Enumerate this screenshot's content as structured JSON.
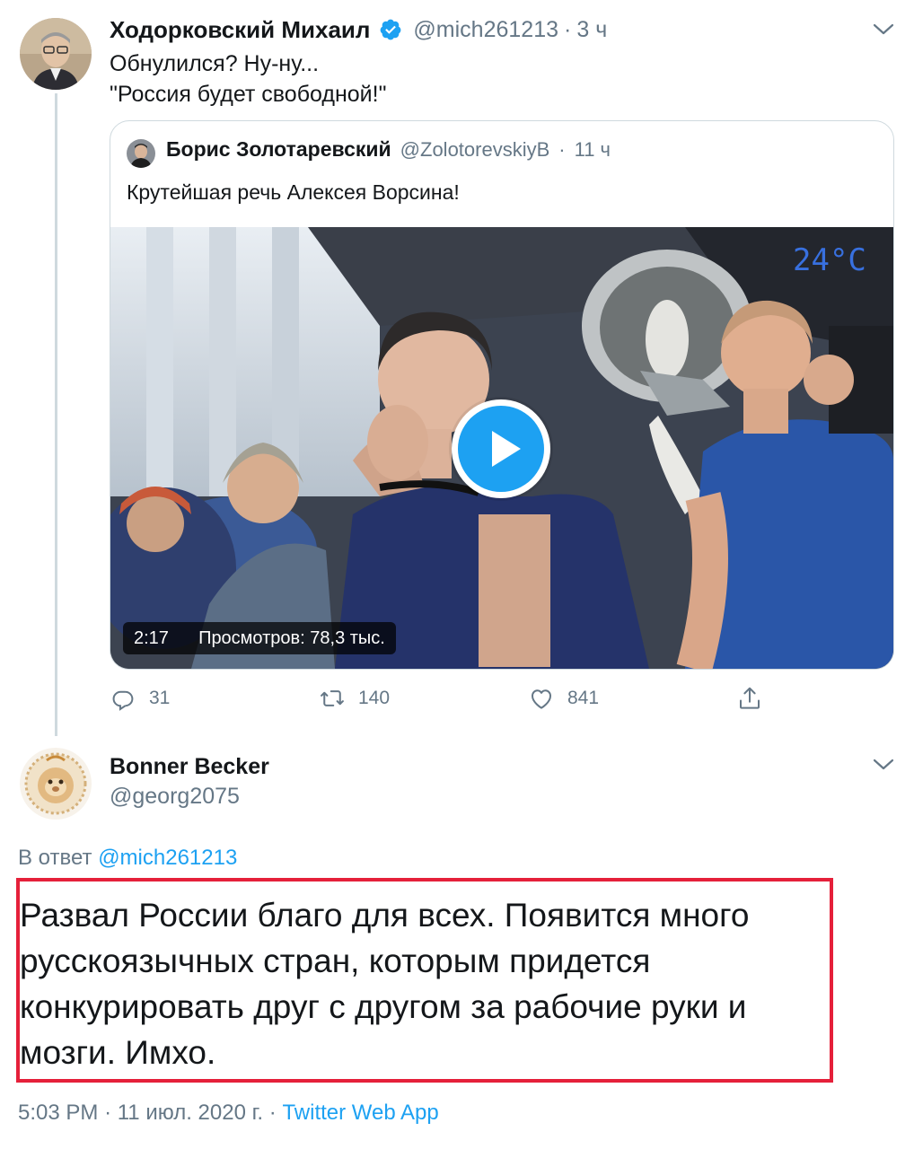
{
  "main_tweet": {
    "display_name": "Ходорковский Михаил",
    "handle": "@mich261213",
    "time": "3 ч",
    "lines": [
      "Обнулился? Ну-ну...",
      "\"Россия будет свободной!\""
    ],
    "quoted": {
      "display_name": "Борис Золотаревский",
      "handle": "@ZolotorevskiyB",
      "time": "11 ч",
      "text": "Крутейшая речь Алексея Ворсина!",
      "video": {
        "duration": "2:17",
        "views": "Просмотров: 78,3 тыс."
      }
    },
    "actions": {
      "reply_count": "31",
      "retweet_count": "140",
      "like_count": "841"
    }
  },
  "reply_tweet": {
    "display_name": "Bonner Becker",
    "handle": "@georg2075",
    "reply_prefix": "В ответ",
    "reply_to": "@mich261213",
    "lines": [
      "Развал России благо для всех. Появится много",
      "русскоязычных стран, которым придется",
      "конкурировать друг с другом за рабочие руки и",
      "мозги. Имхо."
    ],
    "time": "5:03 PM",
    "date": "11 июл. 2020 г.",
    "source": "Twitter Web App"
  },
  "colors": {
    "accent": "#1da1f2",
    "muted": "#657786",
    "border": "#cfd9de",
    "highlight": "#e5203a"
  },
  "icons": [
    "verified-badge-icon",
    "chevron-down-icon",
    "reply-icon",
    "retweet-icon",
    "like-icon",
    "share-icon",
    "play-icon"
  ]
}
